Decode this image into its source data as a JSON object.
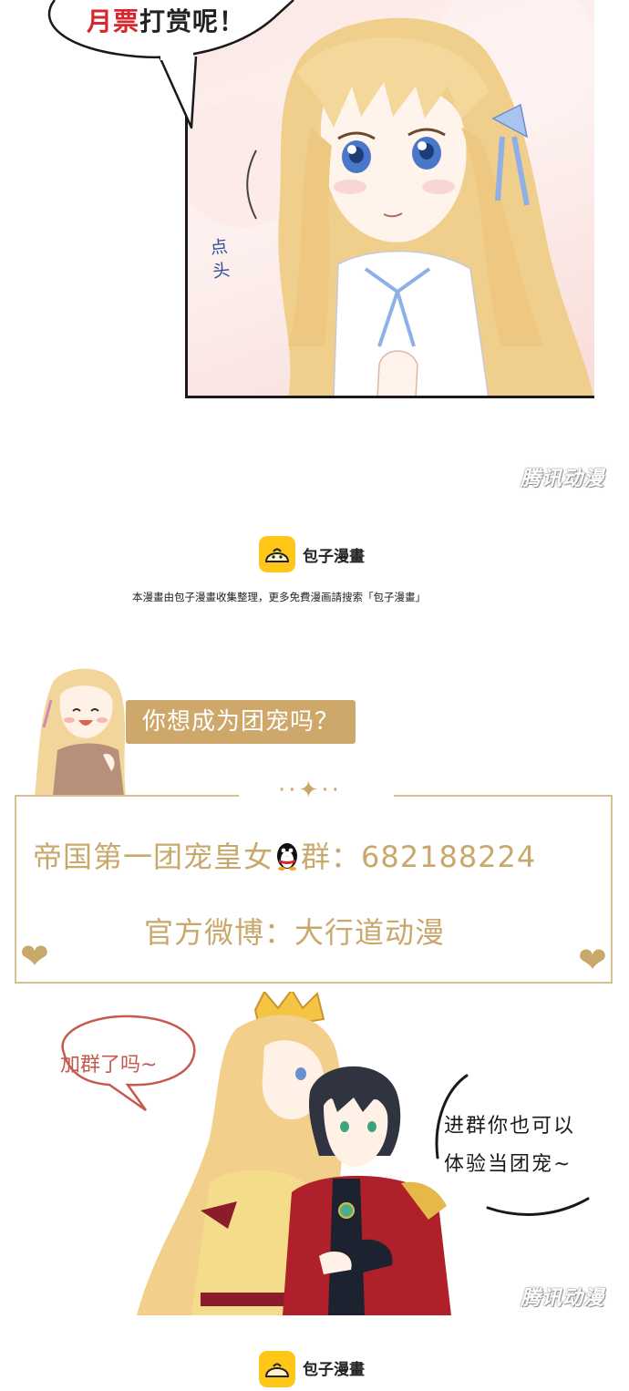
{
  "panel1": {
    "speech_red": "月票",
    "speech_rest": "打赏呢！",
    "onomatopoeia": "点头"
  },
  "watermark": "腾讯动漫",
  "banner": {
    "logo_name": "包子漫畫",
    "notice": "本漫畫由包子漫畫收集整理，更多免費漫画請搜索「包子漫畫」"
  },
  "promo": {
    "question": "你想成为团宠吗？",
    "group_line_prefix": "帝国第一团宠皇女",
    "group_line_suffix": "群：682188224",
    "weibo_line": "官方微博：大行道动漫",
    "bubble_left": "加群了吗~",
    "bubble_right_line1": "进群你也可以",
    "bubble_right_line2": "体验当团宠~"
  },
  "banner_bottom": {
    "logo_name": "包子漫畫"
  },
  "colors": {
    "gold": "#c9a86b",
    "gold_fill": "#cea86a",
    "logo_yellow": "#ffc61a",
    "accent_red": "#d8262e",
    "bubble_red": "#c65a4f"
  }
}
